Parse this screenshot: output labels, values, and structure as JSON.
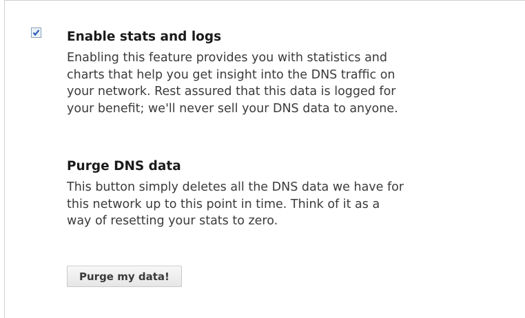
{
  "stats_logs": {
    "checkbox_checked": true,
    "title": "Enable stats and logs",
    "description_lines": [
      "Enabling this feature provides you with statistics and",
      "charts that help you get insight into the DNS traffic on",
      "your network. Rest assured that this data is logged for",
      "your benefit; we'll never sell your DNS data to anyone."
    ]
  },
  "purge": {
    "title": "Purge DNS data",
    "description_lines": [
      "This button simply deletes all the DNS data we have for",
      "this network up to this point in time. Think of it as a",
      "way of resetting your stats to zero."
    ],
    "button_label": "Purge my data!"
  },
  "colors": {
    "checkbox_border": "#7f9db9",
    "checkmark": "#21a121",
    "panel_border": "#cfcfcf"
  }
}
